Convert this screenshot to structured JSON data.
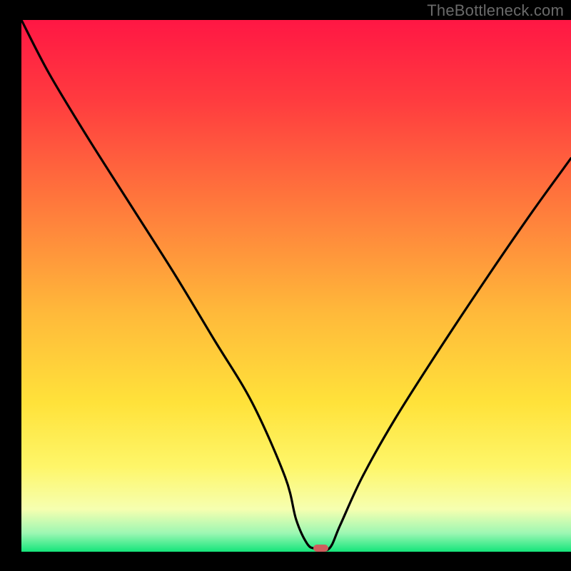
{
  "watermark": {
    "text": "TheBottleneck.com"
  },
  "chart_data": {
    "type": "line",
    "title": "",
    "xlabel": "",
    "ylabel": "",
    "xlim": [
      0,
      100
    ],
    "ylim": [
      0,
      100
    ],
    "grid": false,
    "legend": false,
    "gradient_stops": [
      {
        "offset": 0.0,
        "color": "#ff1744"
      },
      {
        "offset": 0.15,
        "color": "#ff3b3f"
      },
      {
        "offset": 0.35,
        "color": "#ff7a3c"
      },
      {
        "offset": 0.55,
        "color": "#ffb93a"
      },
      {
        "offset": 0.72,
        "color": "#ffe23a"
      },
      {
        "offset": 0.84,
        "color": "#fef669"
      },
      {
        "offset": 0.92,
        "color": "#f6ffb0"
      },
      {
        "offset": 0.965,
        "color": "#9df7b3"
      },
      {
        "offset": 1.0,
        "color": "#15e57b"
      }
    ],
    "series": [
      {
        "name": "bottleneck-curve",
        "x": [
          0,
          5,
          12,
          20,
          28,
          35,
          42,
          48,
          50,
          52,
          53.5,
          56,
          58,
          62,
          68,
          76,
          85,
          93,
          100
        ],
        "values": [
          100,
          90,
          78,
          65,
          52,
          40,
          28,
          14,
          6,
          1.5,
          0.6,
          0.6,
          5,
          14,
          25,
          38,
          52,
          64,
          74
        ]
      }
    ],
    "marker": {
      "name": "optimal-point",
      "x": 54.5,
      "y": 0.7,
      "width_pct": 2.8,
      "height_pct": 1.4,
      "color": "#cf5d5d"
    }
  }
}
